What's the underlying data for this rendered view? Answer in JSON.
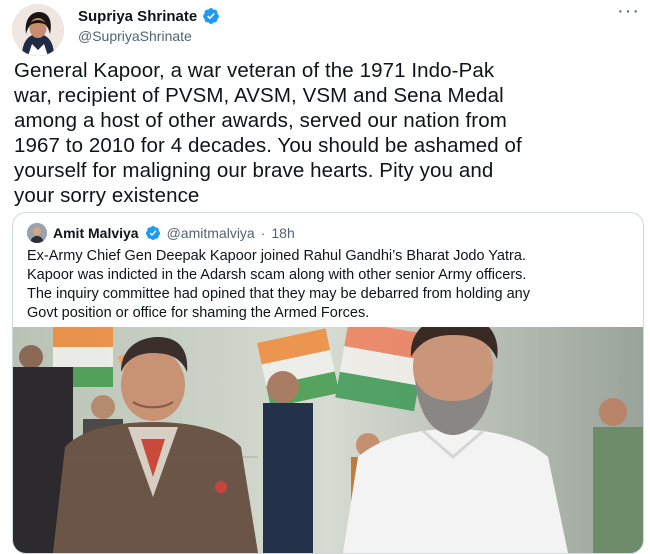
{
  "tweet": {
    "display_name": "Supriya Shrinate",
    "handle": "@SupriyaShrinate",
    "more_icon": "···",
    "text": "General Kapoor, a war veteran of the 1971 Indo-Pak\nwar, recipient of PVSM, AVSM, VSM and Sena Medal\namong a host of other awards, served our nation from\n1967 to 2010 for 4 decades. You should be ashamed of\nyourself for maligning our brave hearts. Pity you and\nyour sorry existence"
  },
  "quote": {
    "display_name": "Amit Malviya",
    "handle": "@amitmalviya",
    "dot": "·",
    "time": "18h",
    "text": "Ex-Army Chief Gen Deepak Kapoor joined Rahul Gandhi’s Bharat Jodo Yatra.\nKapoor was indicted in the Adarsh scam along with other senior Army officers.\nThe inquiry committee had opined that they may be debarred from holding any\nGovt position or office for shaming the Armed Forces."
  },
  "icons": {
    "verified": "verified-badge",
    "more": "more-icon"
  },
  "colors": {
    "verified_blue": "#1d9bf0",
    "secondary_text": "#536471",
    "border": "#cfd9de"
  }
}
